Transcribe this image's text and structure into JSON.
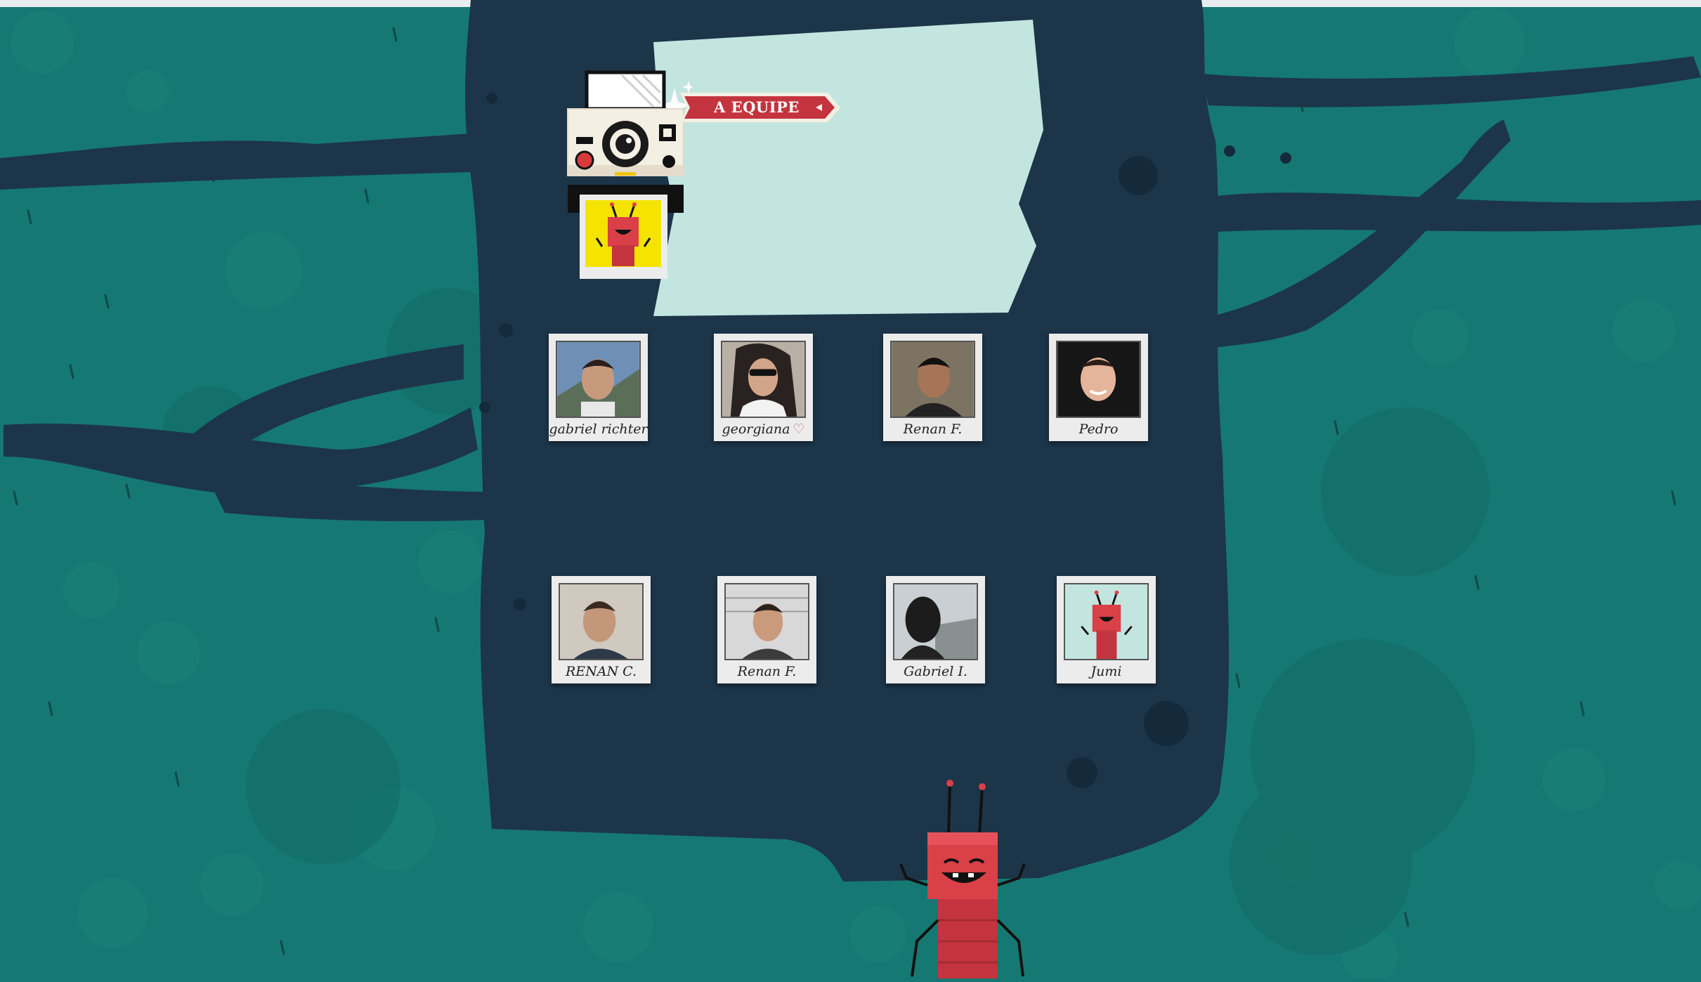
{
  "banner": {
    "label": "A EQUIPE"
  },
  "colors": {
    "grass": "#167872",
    "tunnel": "#1c3549",
    "paper": "#c3e5df",
    "ribbon": "#c4343f",
    "ant": "#d94048",
    "polaroid": "#ececec"
  },
  "camera": {
    "icon": "instant-camera-icon",
    "sparkle_icon": "sparkle-icon"
  },
  "team": [
    {
      "name": "gabriel richter",
      "icon": "member-photo"
    },
    {
      "name": "georgiana",
      "icon": "member-photo",
      "extra_icon": "heart-icon"
    },
    {
      "name": "Renan F.",
      "icon": "member-photo"
    },
    {
      "name": "Pedro",
      "icon": "member-photo"
    },
    {
      "name": "RENAN C.",
      "icon": "member-photo"
    },
    {
      "name": "Renan F.",
      "icon": "member-photo"
    },
    {
      "name": "Gabriel I.",
      "icon": "member-photo"
    },
    {
      "name": "Jumi",
      "icon": "ant-mascot-icon"
    }
  ],
  "mascot": {
    "icon": "ant-mascot-icon"
  }
}
